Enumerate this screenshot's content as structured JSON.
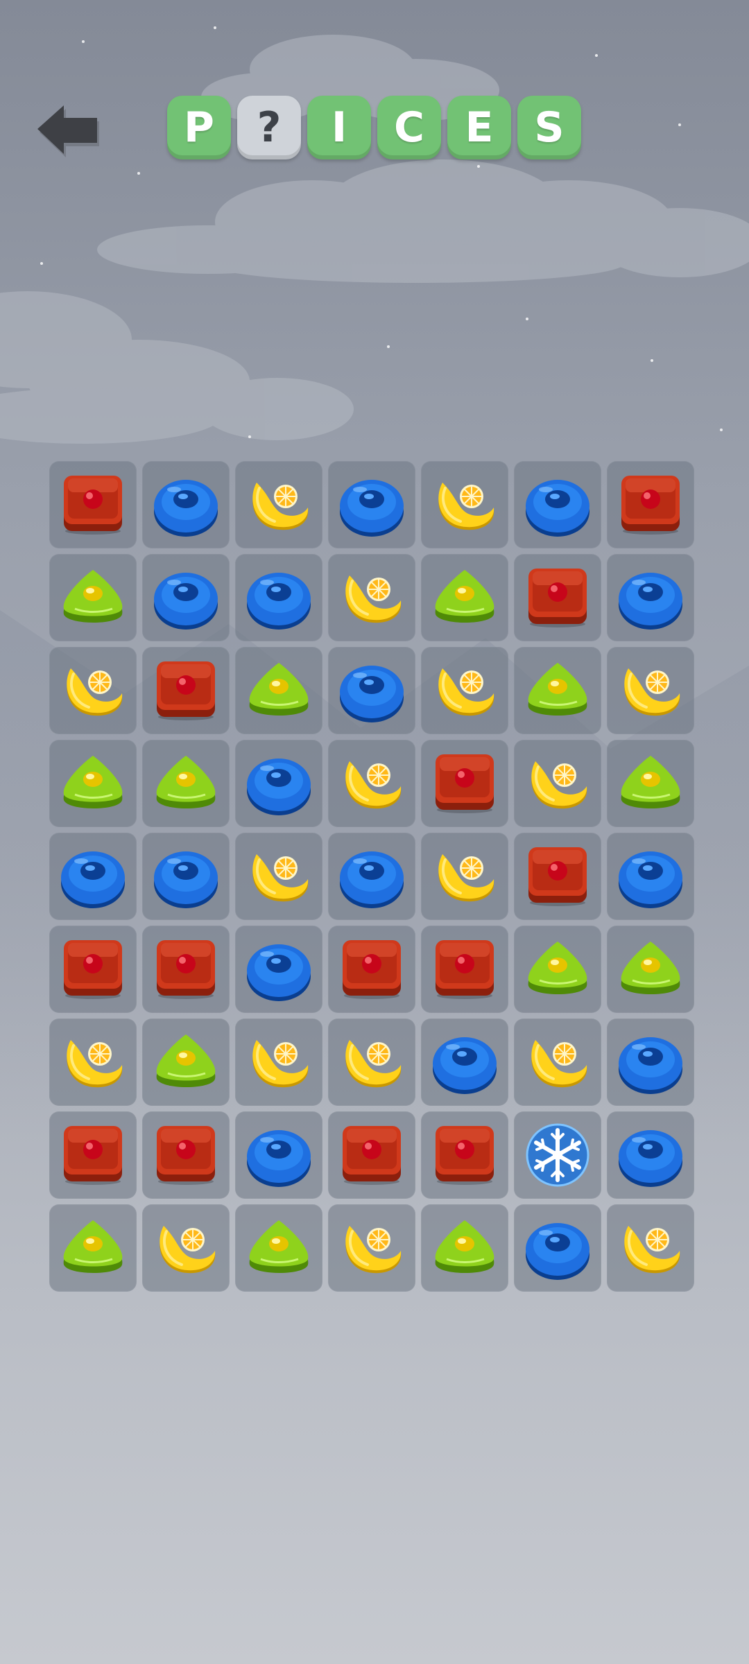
{
  "header": {
    "back_icon": "back-arrow-icon",
    "word_tiles": [
      {
        "letter": "P",
        "hidden": false
      },
      {
        "letter": "?",
        "hidden": true
      },
      {
        "letter": "I",
        "hidden": false
      },
      {
        "letter": "C",
        "hidden": false
      },
      {
        "letter": "E",
        "hidden": false
      },
      {
        "letter": "S",
        "hidden": false
      }
    ]
  },
  "colors": {
    "tile_green": "#72c274",
    "tile_blank": "#cfd3d9",
    "cell_bg": "#6e7684"
  },
  "candy_types": {
    "red": "red-square-candy-icon",
    "blue": "blue-round-candy-icon",
    "yellow": "yellow-lemon-candy-icon",
    "green": "green-triangle-candy-icon",
    "snow": "snowflake-powerup-icon"
  },
  "board": {
    "rows": 9,
    "cols": 7,
    "grid": [
      [
        "red",
        "blue",
        "yellow",
        "blue",
        "yellow",
        "blue",
        "red"
      ],
      [
        "green",
        "blue",
        "blue",
        "yellow",
        "green",
        "red",
        "blue"
      ],
      [
        "yellow",
        "red",
        "green",
        "blue",
        "yellow",
        "green",
        "yellow"
      ],
      [
        "green",
        "green",
        "blue",
        "yellow",
        "red",
        "yellow",
        "green"
      ],
      [
        "blue",
        "blue",
        "yellow",
        "blue",
        "yellow",
        "red",
        "blue"
      ],
      [
        "red",
        "red",
        "blue",
        "red",
        "red",
        "green",
        "green"
      ],
      [
        "yellow",
        "green",
        "yellow",
        "yellow",
        "blue",
        "yellow",
        "blue"
      ],
      [
        "red",
        "red",
        "blue",
        "red",
        "red",
        "snow",
        "blue"
      ],
      [
        "green",
        "yellow",
        "green",
        "yellow",
        "green",
        "blue",
        "yellow"
      ]
    ]
  }
}
